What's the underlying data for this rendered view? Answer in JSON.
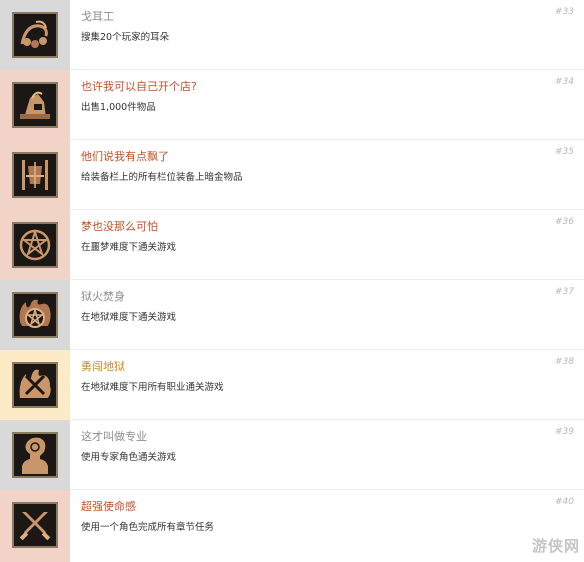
{
  "colors": {
    "side_gray": "#d9d9d9",
    "side_pink": "#f2d3c8",
    "side_cream": "#fdebc8",
    "title_gray": "#8c8c8c",
    "title_red": "#c0502a",
    "title_orange": "#c48a2a",
    "icon_gold": "#c8966a"
  },
  "achievements": [
    {
      "title": "戈耳工",
      "desc": "搜集20个玩家的耳朵",
      "num": "#33",
      "icon": "ear-necklace-icon",
      "state": "locked"
    },
    {
      "title": "也许我可以自己开个店?",
      "desc": "出售1,000件物品",
      "num": "#34",
      "icon": "merchant-pile-icon",
      "state": "unlocked"
    },
    {
      "title": "他们说我有点飘了",
      "desc": "给装备栏上的所有栏位装备上暗金物品",
      "num": "#35",
      "icon": "armor-rack-icon",
      "state": "unlocked"
    },
    {
      "title": "梦也没那么可怕",
      "desc": "在噩梦难度下通关游戏",
      "num": "#36",
      "icon": "pentagram-icon",
      "state": "unlocked"
    },
    {
      "title": "狱火焚身",
      "desc": "在地狱难度下通关游戏",
      "num": "#37",
      "icon": "flaming-pentagram-icon",
      "state": "locked"
    },
    {
      "title": "勇闯地狱",
      "desc": "在地狱难度下用所有职业通关游戏",
      "num": "#38",
      "icon": "crossed-swords-fire-icon",
      "state": "highlight"
    },
    {
      "title": "这才叫做专业",
      "desc": "使用专家角色通关游戏",
      "num": "#39",
      "icon": "head-sigil-icon",
      "state": "locked"
    },
    {
      "title": "超强使命感",
      "desc": "使用一个角色完成所有章节任务",
      "num": "#40",
      "icon": "crossed-swords-icon",
      "state": "unlocked"
    }
  ],
  "watermark": {
    "text": "游侠网"
  }
}
